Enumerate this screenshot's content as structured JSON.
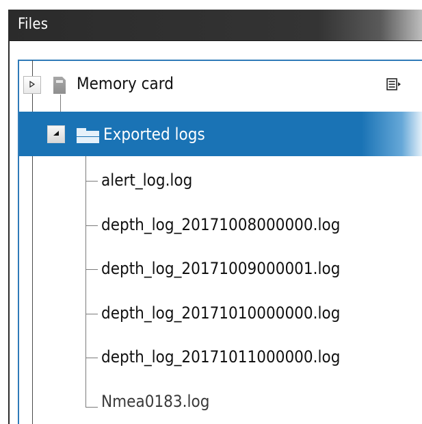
{
  "window": {
    "title": "Files"
  },
  "tree": {
    "root": {
      "label": "Memory card",
      "icon": "sd-card-icon",
      "expanded": false
    },
    "folder": {
      "label": "Exported logs",
      "icon": "folder-icon",
      "expanded": true,
      "selected": true
    },
    "files": [
      {
        "label": "alert_log.log"
      },
      {
        "label": "depth_log_20171008000000.log"
      },
      {
        "label": "depth_log_20171009000001.log"
      },
      {
        "label": "depth_log_20171010000000.log"
      },
      {
        "label": "depth_log_20171011000000.log"
      },
      {
        "label": "Nmea0183.log"
      }
    ]
  },
  "icons": {
    "collapsed_expander": "triangle-right-icon",
    "expanded_expander": "triangle-up-icon",
    "context_menu": "list-menu-icon"
  },
  "colors": {
    "selection": "#1a73b5",
    "title_bar": "#2b2b2b",
    "panel_border": "#2e7ab8"
  }
}
